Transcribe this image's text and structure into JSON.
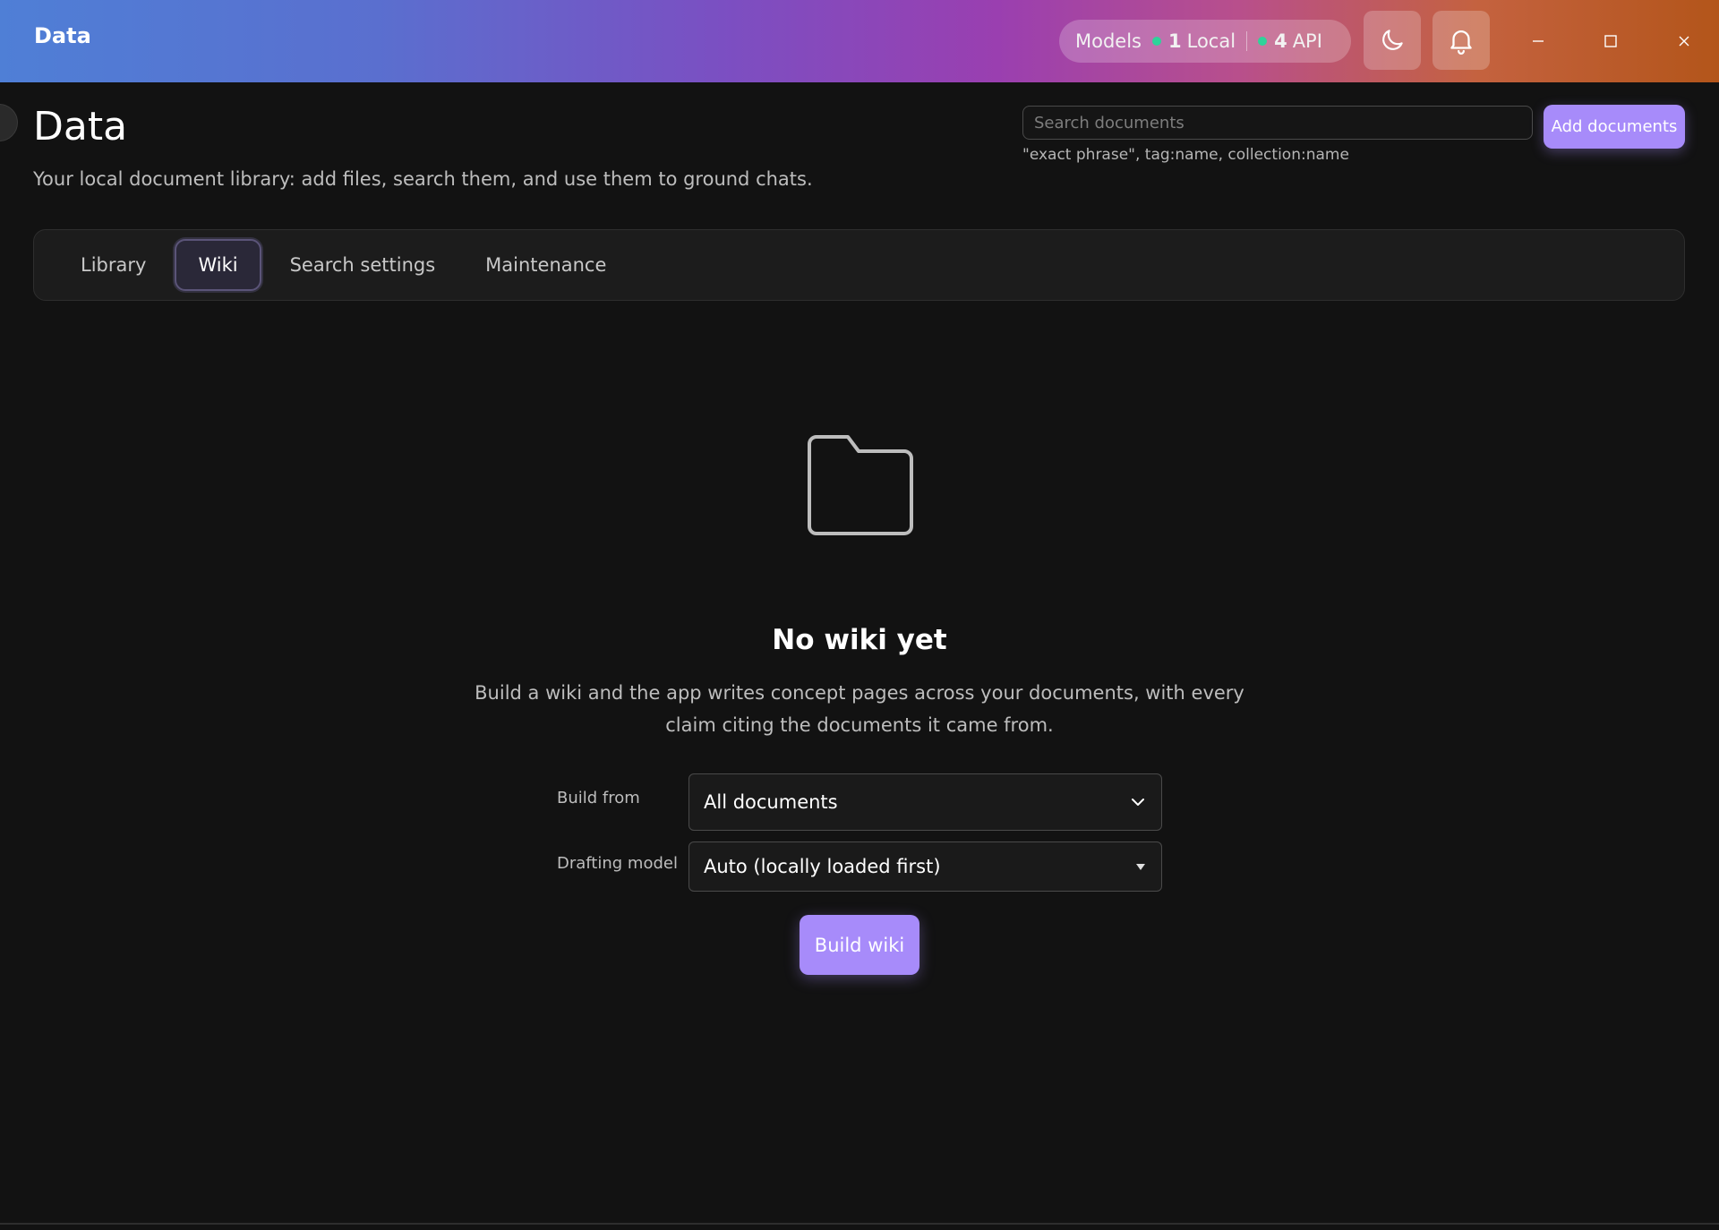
{
  "window": {
    "title": "Data"
  },
  "header": {
    "models_label": "Models",
    "local_count": "1",
    "local_label": "Local",
    "api_count": "4",
    "api_label": "API",
    "status_color": "#2ed39a"
  },
  "page": {
    "title": "Data",
    "subtitle": "Your local document library: add files, search them, and use them to ground chats."
  },
  "search": {
    "placeholder": "Search documents",
    "hint": "\"exact phrase\", tag:name, collection:name"
  },
  "actions": {
    "add_documents": "Add documents"
  },
  "tabs": [
    {
      "label": "Library",
      "active": false
    },
    {
      "label": "Wiki",
      "active": true
    },
    {
      "label": "Search settings",
      "active": false
    },
    {
      "label": "Maintenance",
      "active": false
    }
  ],
  "empty_state": {
    "icon": "folder-icon",
    "title": "No wiki yet",
    "description": "Build a wiki and the app writes concept pages across your documents, with every claim citing the documents it came from."
  },
  "form": {
    "build_from_label": "Build from",
    "build_from_value": "All documents",
    "drafting_model_label": "Drafting model",
    "drafting_model_value": "Auto (locally loaded first)",
    "build_button": "Build wiki"
  },
  "colors": {
    "accent": "#a78bfa",
    "background": "#121212"
  }
}
